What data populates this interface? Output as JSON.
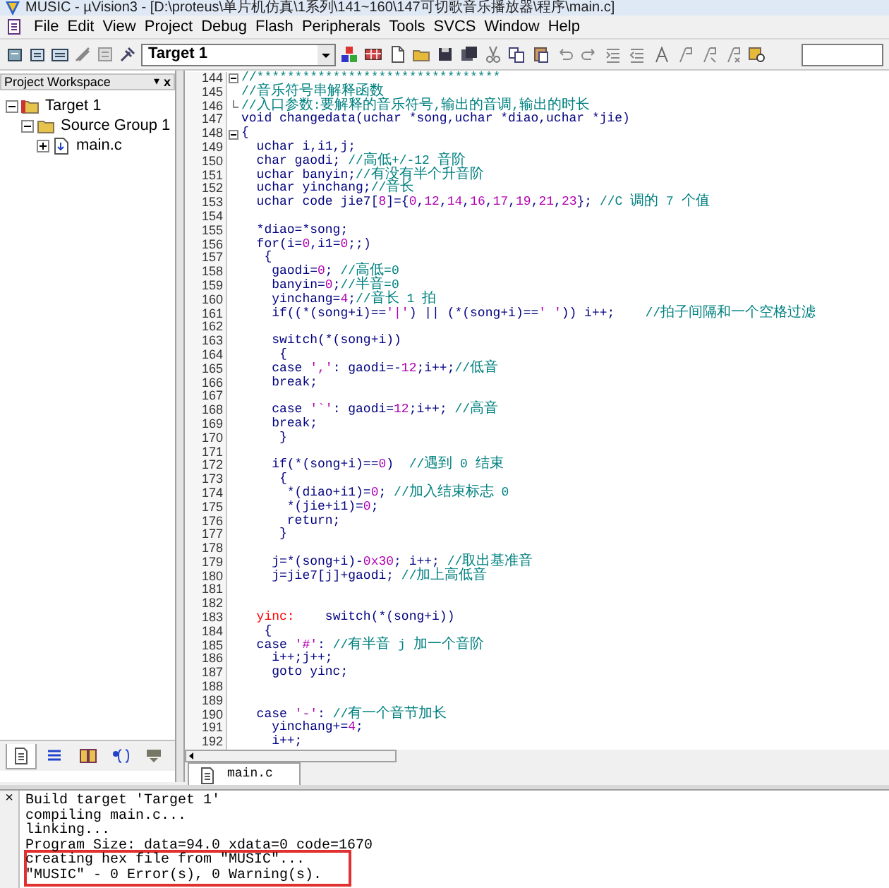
{
  "window": {
    "title": "MUSIC - µVision3 - [D:\\proteus\\单片机仿真\\1系列\\141~160\\147可切歌音乐播放器\\程序\\main.c]"
  },
  "menu": [
    "File",
    "Edit",
    "View",
    "Project",
    "Debug",
    "Flash",
    "Peripherals",
    "Tools",
    "SVCS",
    "Window",
    "Help"
  ],
  "toolbar": {
    "target": "Target 1"
  },
  "workspace": {
    "title": "Project Workspace",
    "pin": "▾",
    "close": "x",
    "tree": [
      {
        "label": "Target 1",
        "kind": "target",
        "expanded": true,
        "children": [
          {
            "label": "Source Group 1",
            "kind": "group",
            "expanded": true,
            "children": [
              {
                "label": "main.c",
                "kind": "file",
                "expanded": false
              }
            ]
          }
        ]
      }
    ],
    "tabs": [
      {
        "selected": true
      },
      {
        "selected": false
      },
      {
        "selected": false
      },
      {
        "selected": false
      },
      {
        "selected": false
      }
    ]
  },
  "editor": {
    "lines": [
      {
        "n": "144",
        "expanded": true,
        "comment": "//********************************"
      },
      {
        "n": "145",
        "comment": "//音乐符号串解释函数"
      },
      {
        "n": "146",
        "fold_end": true,
        "comment": "//入口参数:要解释的音乐符号,输出的音调,输出的时长"
      },
      {
        "n": "147",
        "code": "void changedata(uchar *song,uchar *diao,uchar *jie)"
      },
      {
        "n": "148",
        "expanded": true,
        "code": "{"
      },
      {
        "n": "149",
        "code": "  uchar i,i1,j;"
      },
      {
        "n": "150",
        "code": "  char gaodi; ",
        "comment": "//高低+/-12 音阶"
      },
      {
        "n": "151",
        "code": "  uchar banyin;",
        "comment": "//有没有半个升音阶"
      },
      {
        "n": "152",
        "code": "  uchar yinchang;",
        "comment": "//音长"
      },
      {
        "n": "153",
        "code": "  uchar code jie7[8]={0,12,14,16,17,19,21,23}; ",
        "comment": "//C 调的 7 个值"
      },
      {
        "n": "154"
      },
      {
        "n": "155",
        "code": "  *diao=*song;"
      },
      {
        "n": "156",
        "code": "  for(i=0,i1=0;;)"
      },
      {
        "n": "157",
        "code": "   {"
      },
      {
        "n": "158",
        "code": "    gaodi=0; ",
        "comment": "//高低=0"
      },
      {
        "n": "159",
        "code": "    banyin=0;",
        "comment": "//半音=0"
      },
      {
        "n": "160",
        "code": "    yinchang=4;",
        "comment": "//音长 1 拍"
      },
      {
        "n": "161",
        "code": "    if((*(song+i)=='|') || (*(song+i)==' ')) i++;    ",
        "comment": "//拍子间隔和一个空格过滤"
      },
      {
        "n": "162"
      },
      {
        "n": "163",
        "code": "    switch(*(song+i))"
      },
      {
        "n": "164",
        "code": "     {"
      },
      {
        "n": "165",
        "code": "    case ',': gaodi=-12;i++;",
        "comment": "//低音"
      },
      {
        "n": "166",
        "code": "    break;"
      },
      {
        "n": "167"
      },
      {
        "n": "168",
        "code": "    case '`': gaodi=12;i++; ",
        "comment": "//高音"
      },
      {
        "n": "169",
        "code": "    break;"
      },
      {
        "n": "170",
        "code": "     }"
      },
      {
        "n": "171"
      },
      {
        "n": "172",
        "code": "    if(*(song+i)==0)  ",
        "comment": "//遇到 0 结束"
      },
      {
        "n": "173",
        "code": "     {"
      },
      {
        "n": "174",
        "code": "      *(diao+i1)=0; ",
        "comment": "//加入结束标志 0"
      },
      {
        "n": "175",
        "code": "      *(jie+i1)=0;"
      },
      {
        "n": "176",
        "code": "      return;"
      },
      {
        "n": "177",
        "code": "     }"
      },
      {
        "n": "178"
      },
      {
        "n": "179",
        "code": "    j=*(song+i)-0x30; i++; ",
        "comment": "//取出基准音"
      },
      {
        "n": "180",
        "code": "    j=jie7[j]+gaodi; ",
        "comment": "//加上高低音"
      },
      {
        "n": "181"
      },
      {
        "n": "182"
      },
      {
        "n": "183",
        "label": "  yinc:",
        "code": "    switch(*(song+i))"
      },
      {
        "n": "184",
        "code": "   {"
      },
      {
        "n": "185",
        "code": "  case '#': ",
        "comment": "//有半音 j 加一个音阶"
      },
      {
        "n": "186",
        "code": "    i++;j++;"
      },
      {
        "n": "187",
        "code": "    goto yinc;"
      },
      {
        "n": "188"
      },
      {
        "n": "189"
      },
      {
        "n": "190",
        "code": "  case '-': ",
        "comment": "//有一个音节加长"
      },
      {
        "n": "191",
        "code": "    yinchang+=4;"
      },
      {
        "n": "192",
        "code": "    i++;"
      }
    ],
    "tabs": [
      {
        "label": "main.c",
        "selected": true
      }
    ]
  },
  "output": {
    "close": "×",
    "lines": [
      "Build target 'Target 1'",
      "compiling main.c...",
      "linking...",
      "Program Size: data=94.0 xdata=0 code=1670",
      "creating hex file from \"MUSIC\"...",
      "\"MUSIC\" - 0 Error(s), 0 Warning(s)."
    ]
  }
}
